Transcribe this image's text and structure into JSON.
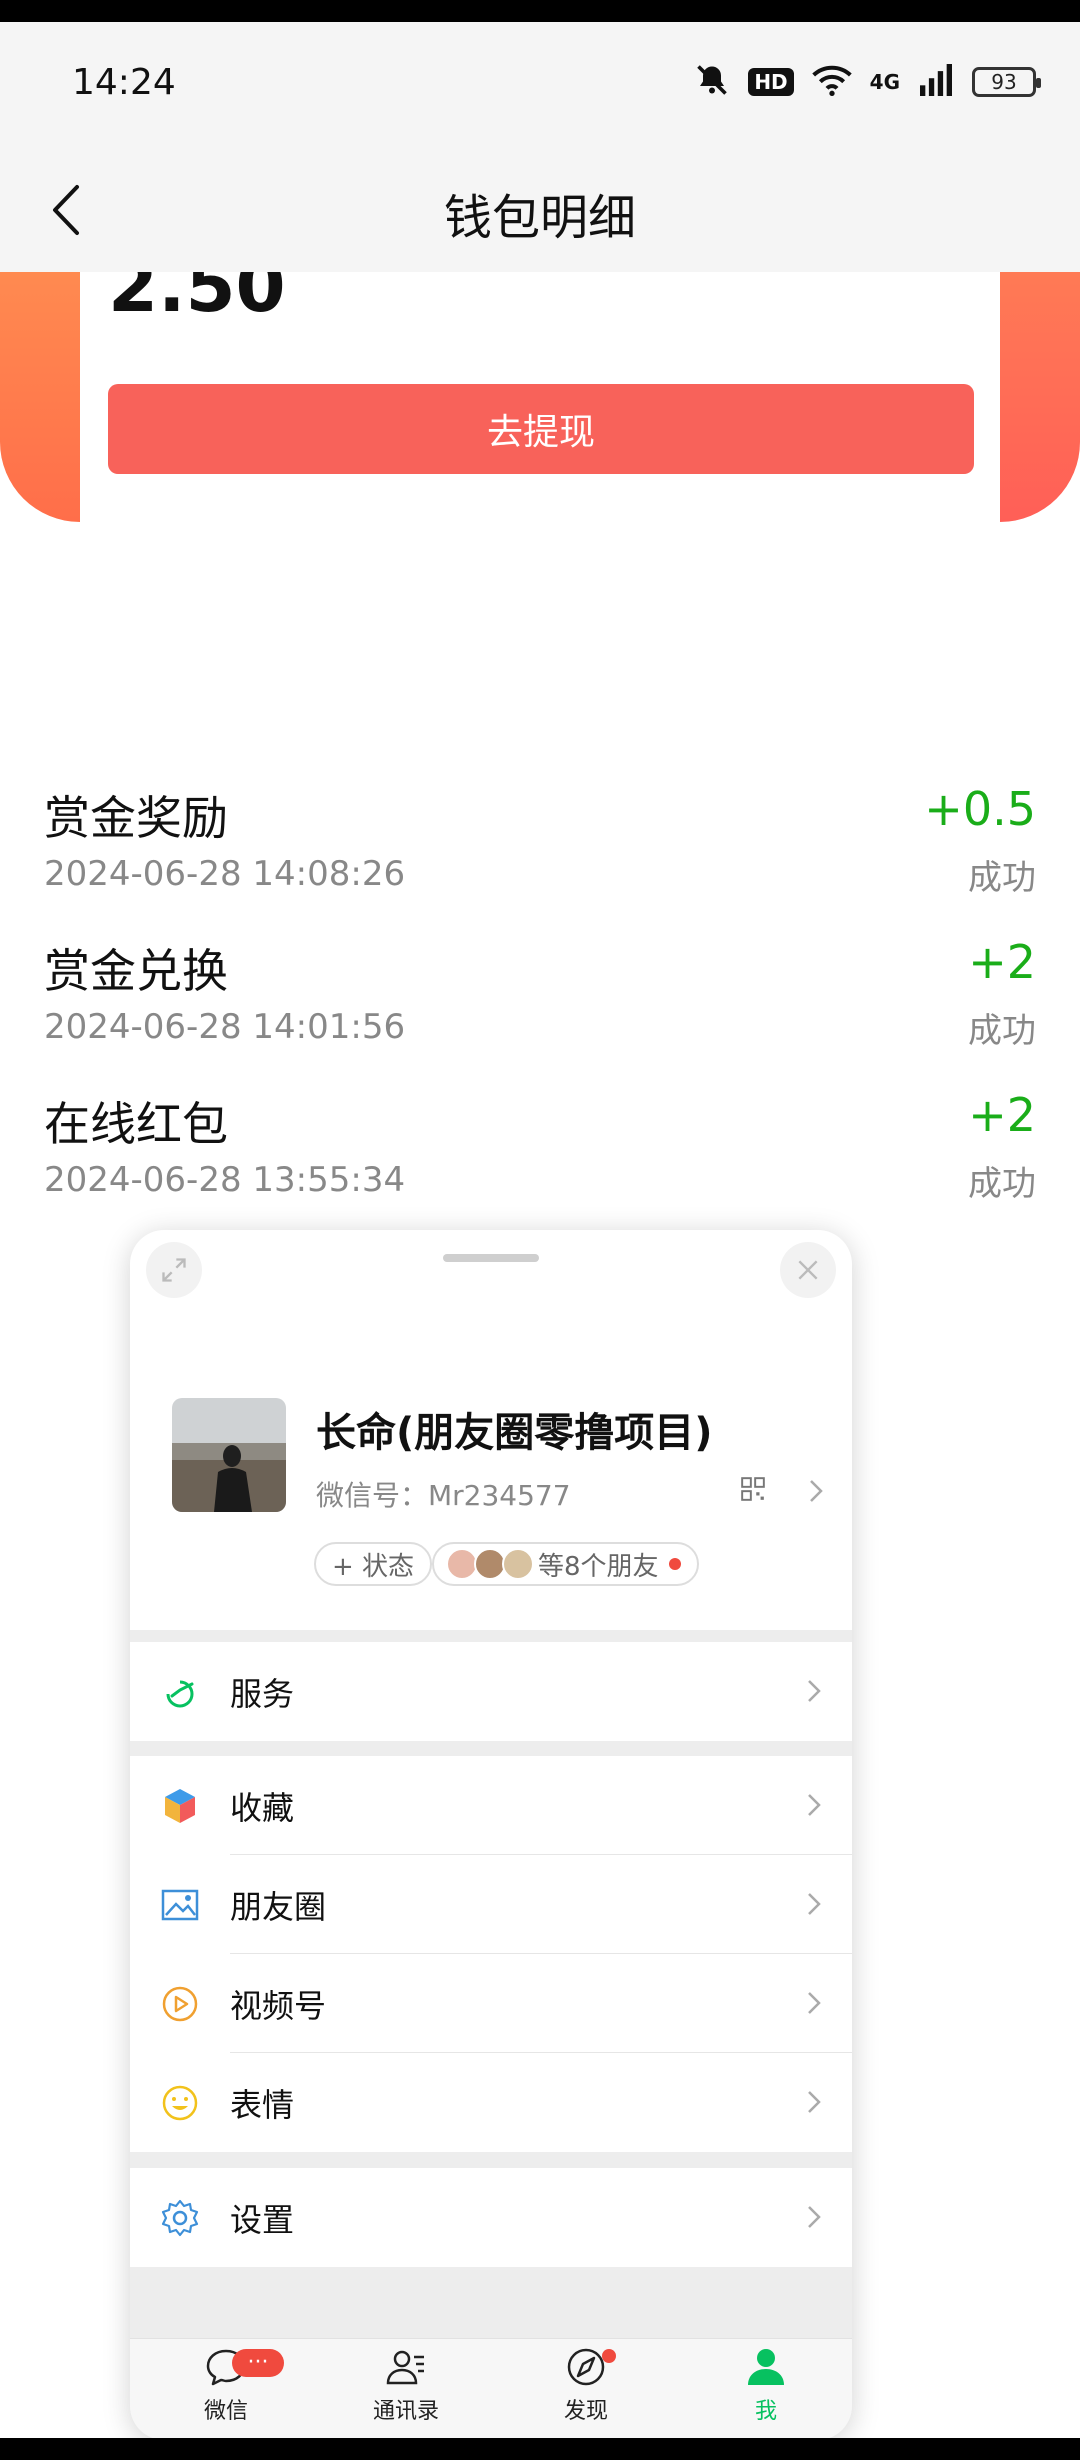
{
  "status_bar": {
    "time": "14:24",
    "network": "4G",
    "battery": "93"
  },
  "header": {
    "title": "钱包明细"
  },
  "wallet": {
    "balance": "2.50",
    "withdraw_label": "去提现",
    "accent": "#f8625a"
  },
  "transactions": [
    {
      "title": "赏金奖励",
      "date": "2024-06-28 14:08:26",
      "amount": "+0.5",
      "status": "成功"
    },
    {
      "title": "赏金兑换",
      "date": "2024-06-28 14:01:56",
      "amount": "+2",
      "status": "成功"
    },
    {
      "title": "在线红包",
      "date": "2024-06-28 13:55:34",
      "amount": "+2",
      "status": "成功"
    }
  ],
  "wechat": {
    "profile": {
      "nickname": "长命(朋友圈零撸项目)",
      "wechat_id": "微信号：Mr234577",
      "status_label": "+ 状态",
      "friends_label": "等8个朋友"
    },
    "menu": [
      {
        "label": "服务",
        "icon": "service-icon"
      },
      {
        "label": "收藏",
        "icon": "favorites-icon"
      },
      {
        "label": "朋友圈",
        "icon": "moments-icon"
      },
      {
        "label": "视频号",
        "icon": "channels-icon"
      },
      {
        "label": "表情",
        "icon": "sticker-icon"
      },
      {
        "label": "设置",
        "icon": "settings-icon"
      }
    ],
    "tabs": [
      {
        "label": "微信",
        "badge": "···"
      },
      {
        "label": "通讯录"
      },
      {
        "label": "发现"
      },
      {
        "label": "我",
        "active": true
      }
    ],
    "accent_green": "#07c160"
  }
}
